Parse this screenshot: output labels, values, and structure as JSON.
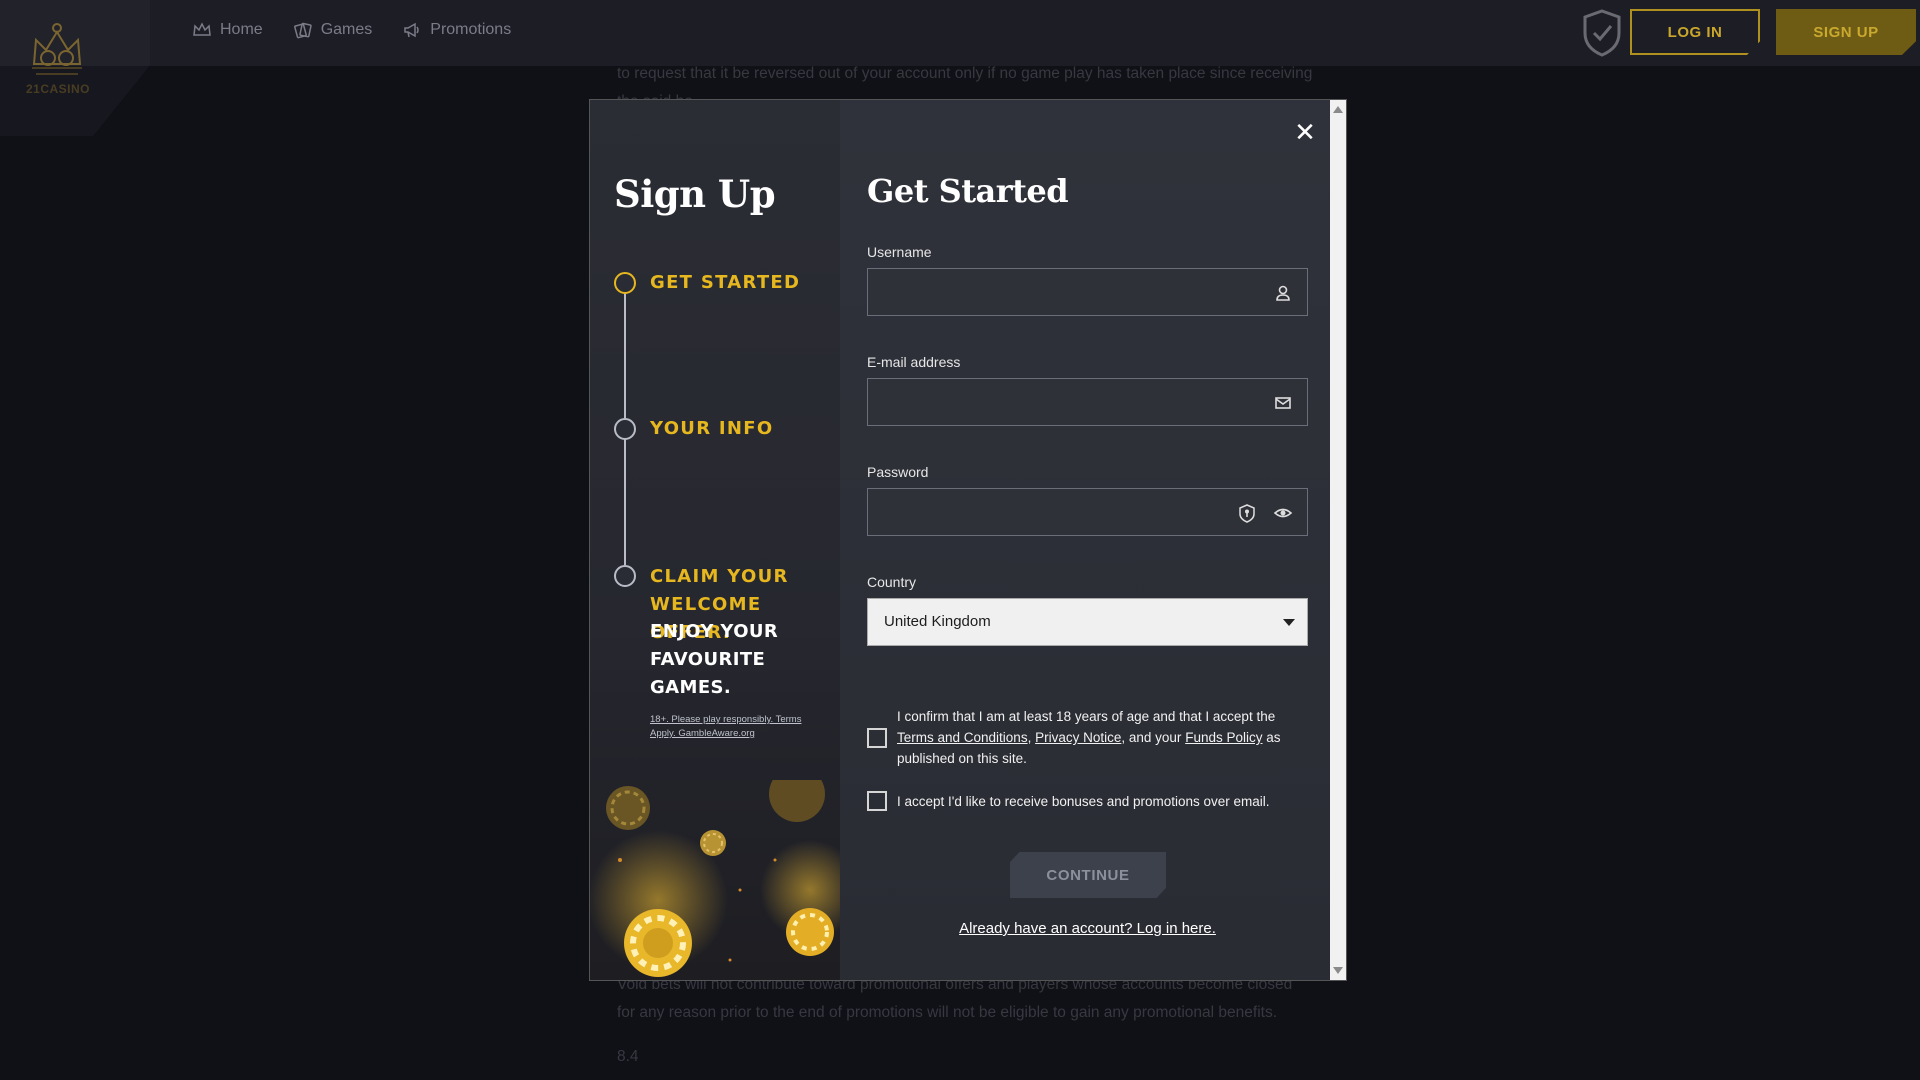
{
  "brand": {
    "logo_text": "21CASINO"
  },
  "nav": {
    "items": [
      {
        "label": "Home",
        "icon": "crown-icon"
      },
      {
        "label": "Games",
        "icon": "cards-icon"
      },
      {
        "label": "Promotions",
        "icon": "megaphone-icon"
      }
    ]
  },
  "header": {
    "login_label": "LOG IN",
    "signup_label": "SIGN UP"
  },
  "background_text": {
    "top_line": "to request that it be reversed out of your account only if no game play has taken place since receiving",
    "top_line_2": "the said be",
    "bottom_line_1": "Void bets will not contribute toward promotional offers and players whose accounts become closed",
    "bottom_line_2": "for any reason prior to the end of promotions will not be eligible to gain any promotional benefits.",
    "section_number": "8.4"
  },
  "modal": {
    "title_left": "Sign Up",
    "title_right": "Get Started",
    "close_symbol": "✕",
    "steps": [
      {
        "label": "GET STARTED",
        "active": true
      },
      {
        "label": "YOUR INFO",
        "active": false
      },
      {
        "label": "CLAIM YOUR WELCOME OFFER.",
        "active": false
      }
    ],
    "step_sub": "ENJOY YOUR FAVOURITE GAMES.",
    "legal_small": "18+. Please play responsibly. Terms Apply. GambleAware.org",
    "form": {
      "username_label": "Username",
      "username_value": "",
      "email_label": "E-mail address",
      "email_value": "",
      "password_label": "Password",
      "password_value": "",
      "country_label": "Country",
      "country_value": "United Kingdom"
    },
    "consent": {
      "part1": "I confirm that I am at least 18 years of age and that I accept the",
      "terms_link": "Terms and Conditions",
      "sep1": ",",
      "privacy_link": "Privacy Notice",
      "sep2": ", and your",
      "funds_link": "Funds Policy",
      "part2": "as published on this site."
    },
    "marketing_text": "I accept I'd like to receive bonuses and promotions over email.",
    "continue_label": "CONTINUE",
    "login_link": "Already have an account? Log in here."
  },
  "colors": {
    "accent": "#e6b71f",
    "bg": "#14141c",
    "modal": "#2a2c35"
  }
}
